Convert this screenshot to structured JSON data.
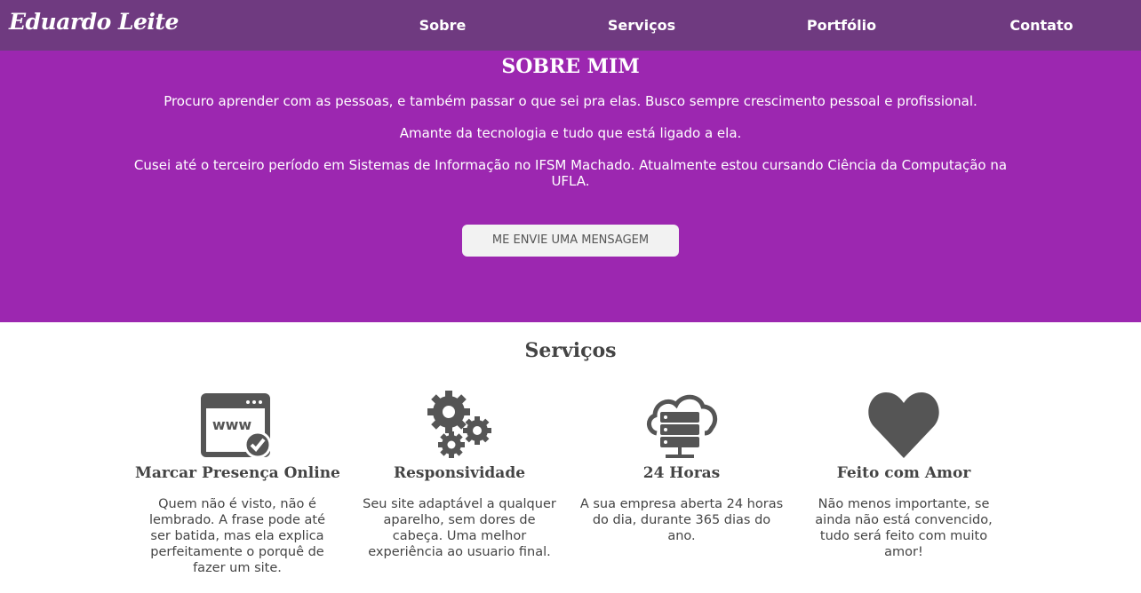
{
  "nav": {
    "brand": "Eduardo Leite",
    "links": [
      {
        "label": "Sobre"
      },
      {
        "label": "Serviços"
      },
      {
        "label": "Portfólio"
      },
      {
        "label": "Contato"
      }
    ]
  },
  "about": {
    "title": "SOBRE MIM",
    "paragraphs": [
      "Procuro aprender com as pessoas, e também passar o que sei pra elas. Busco sempre crescimento pessoal e profissional.",
      "Amante da tecnologia e tudo que está ligado a ela.",
      "Cusei até o terceiro período em Sistemas de Informação no IFSM Machado. Atualmente estou cursando Ciência da Computação na UFLA."
    ],
    "cta_label": "ME ENVIE UMA MENSAGEM"
  },
  "services": {
    "title": "Serviços",
    "items": [
      {
        "icon": "browser-www-check-icon",
        "title": "Marcar Presença Online",
        "description": "Quem não é visto, não é lembrado. A frase pode até ser batida, mas ela explica perfeitamente o porquê de fazer um site."
      },
      {
        "icon": "gears-icon",
        "title": "Responsividade",
        "description": "Seu site adaptável a qualquer aparelho, sem dores de cabeça. Uma melhor experiência ao usuario final."
      },
      {
        "icon": "cloud-server-icon",
        "title": "24 Horas",
        "description": "A sua empresa aberta 24 horas do dia, durante 365 dias do ano."
      },
      {
        "icon": "heart-icon",
        "title": "Feito com Amor",
        "description": "Não menos importante, se ainda não está convencido, tudo será feito com muito amor!"
      }
    ]
  },
  "colors": {
    "navbar": "#6f3a80",
    "hero": "#9c27b0",
    "text_dark": "#444444",
    "icon": "#555555"
  }
}
